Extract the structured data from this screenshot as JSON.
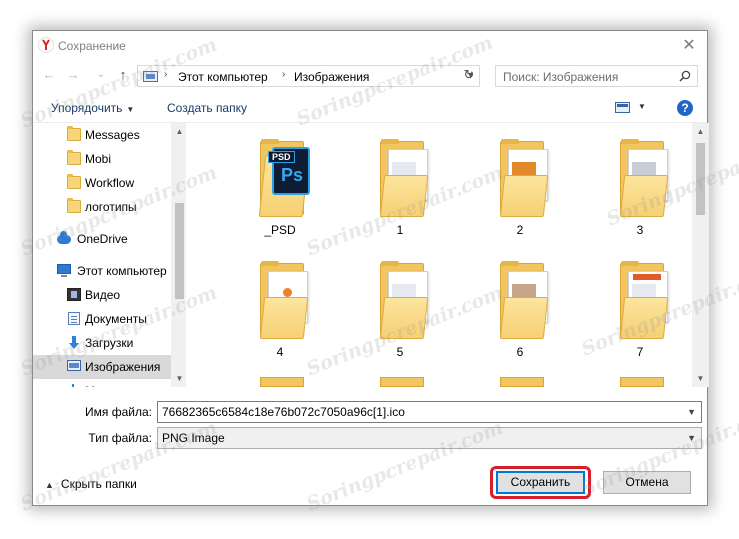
{
  "window": {
    "title": "Сохранение",
    "close_glyph": "✕"
  },
  "nav": {
    "back_glyph": "←",
    "forward_glyph": "→",
    "up_history_glyph": "⌄",
    "up_glyph": "↑",
    "breadcrumb": [
      "Этот компьютер",
      "Изображения"
    ],
    "crumb_separator": "›",
    "refresh_glyph": "↻",
    "search_placeholder": "Поиск: Изображения"
  },
  "toolbar": {
    "organize_label": "Упорядочить",
    "new_folder_label": "Создать папку",
    "help_label": "?"
  },
  "sidebar": {
    "items": [
      {
        "label": "Messages",
        "icon": "folder-icon"
      },
      {
        "label": "Mobi",
        "icon": "folder-icon"
      },
      {
        "label": "Workflow",
        "icon": "folder-icon"
      },
      {
        "label": "логотипы",
        "icon": "folder-icon"
      },
      {
        "label": "OneDrive",
        "icon": "onedrive-icon"
      },
      {
        "label": "Этот компьютер",
        "icon": "computer-icon"
      },
      {
        "label": "Видео",
        "icon": "video-icon"
      },
      {
        "label": "Документы",
        "icon": "documents-icon"
      },
      {
        "label": "Загрузки",
        "icon": "downloads-icon"
      },
      {
        "label": "Изображения",
        "icon": "pictures-icon",
        "selected": true
      },
      {
        "label": "М",
        "icon": "music-icon"
      }
    ]
  },
  "files": [
    {
      "name": "_PSD",
      "type": "psd"
    },
    {
      "name": "1",
      "type": "folder"
    },
    {
      "name": "2",
      "type": "folder"
    },
    {
      "name": "3",
      "type": "folder"
    },
    {
      "name": "4",
      "type": "folder"
    },
    {
      "name": "5",
      "type": "folder"
    },
    {
      "name": "6",
      "type": "folder"
    },
    {
      "name": "7",
      "type": "folder"
    }
  ],
  "psd_badge": "PSD",
  "psd_letters": "Ps",
  "form": {
    "filename_label": "Имя файла:",
    "filename_value": "76682365c6584c18e76b072c7050a96c[1].ico",
    "filetype_label": "Тип файла:",
    "filetype_value": "PNG Image"
  },
  "footer": {
    "hide_folders_label": "Скрыть папки",
    "save_label": "Сохранить",
    "cancel_label": "Отмена"
  },
  "watermark_text": "Soringpcrepair.com",
  "colors": {
    "accent": "#0078d7",
    "highlight_ring": "#d61f2a",
    "selected_row": "#d9d9d9",
    "folder": "#f6d074"
  }
}
